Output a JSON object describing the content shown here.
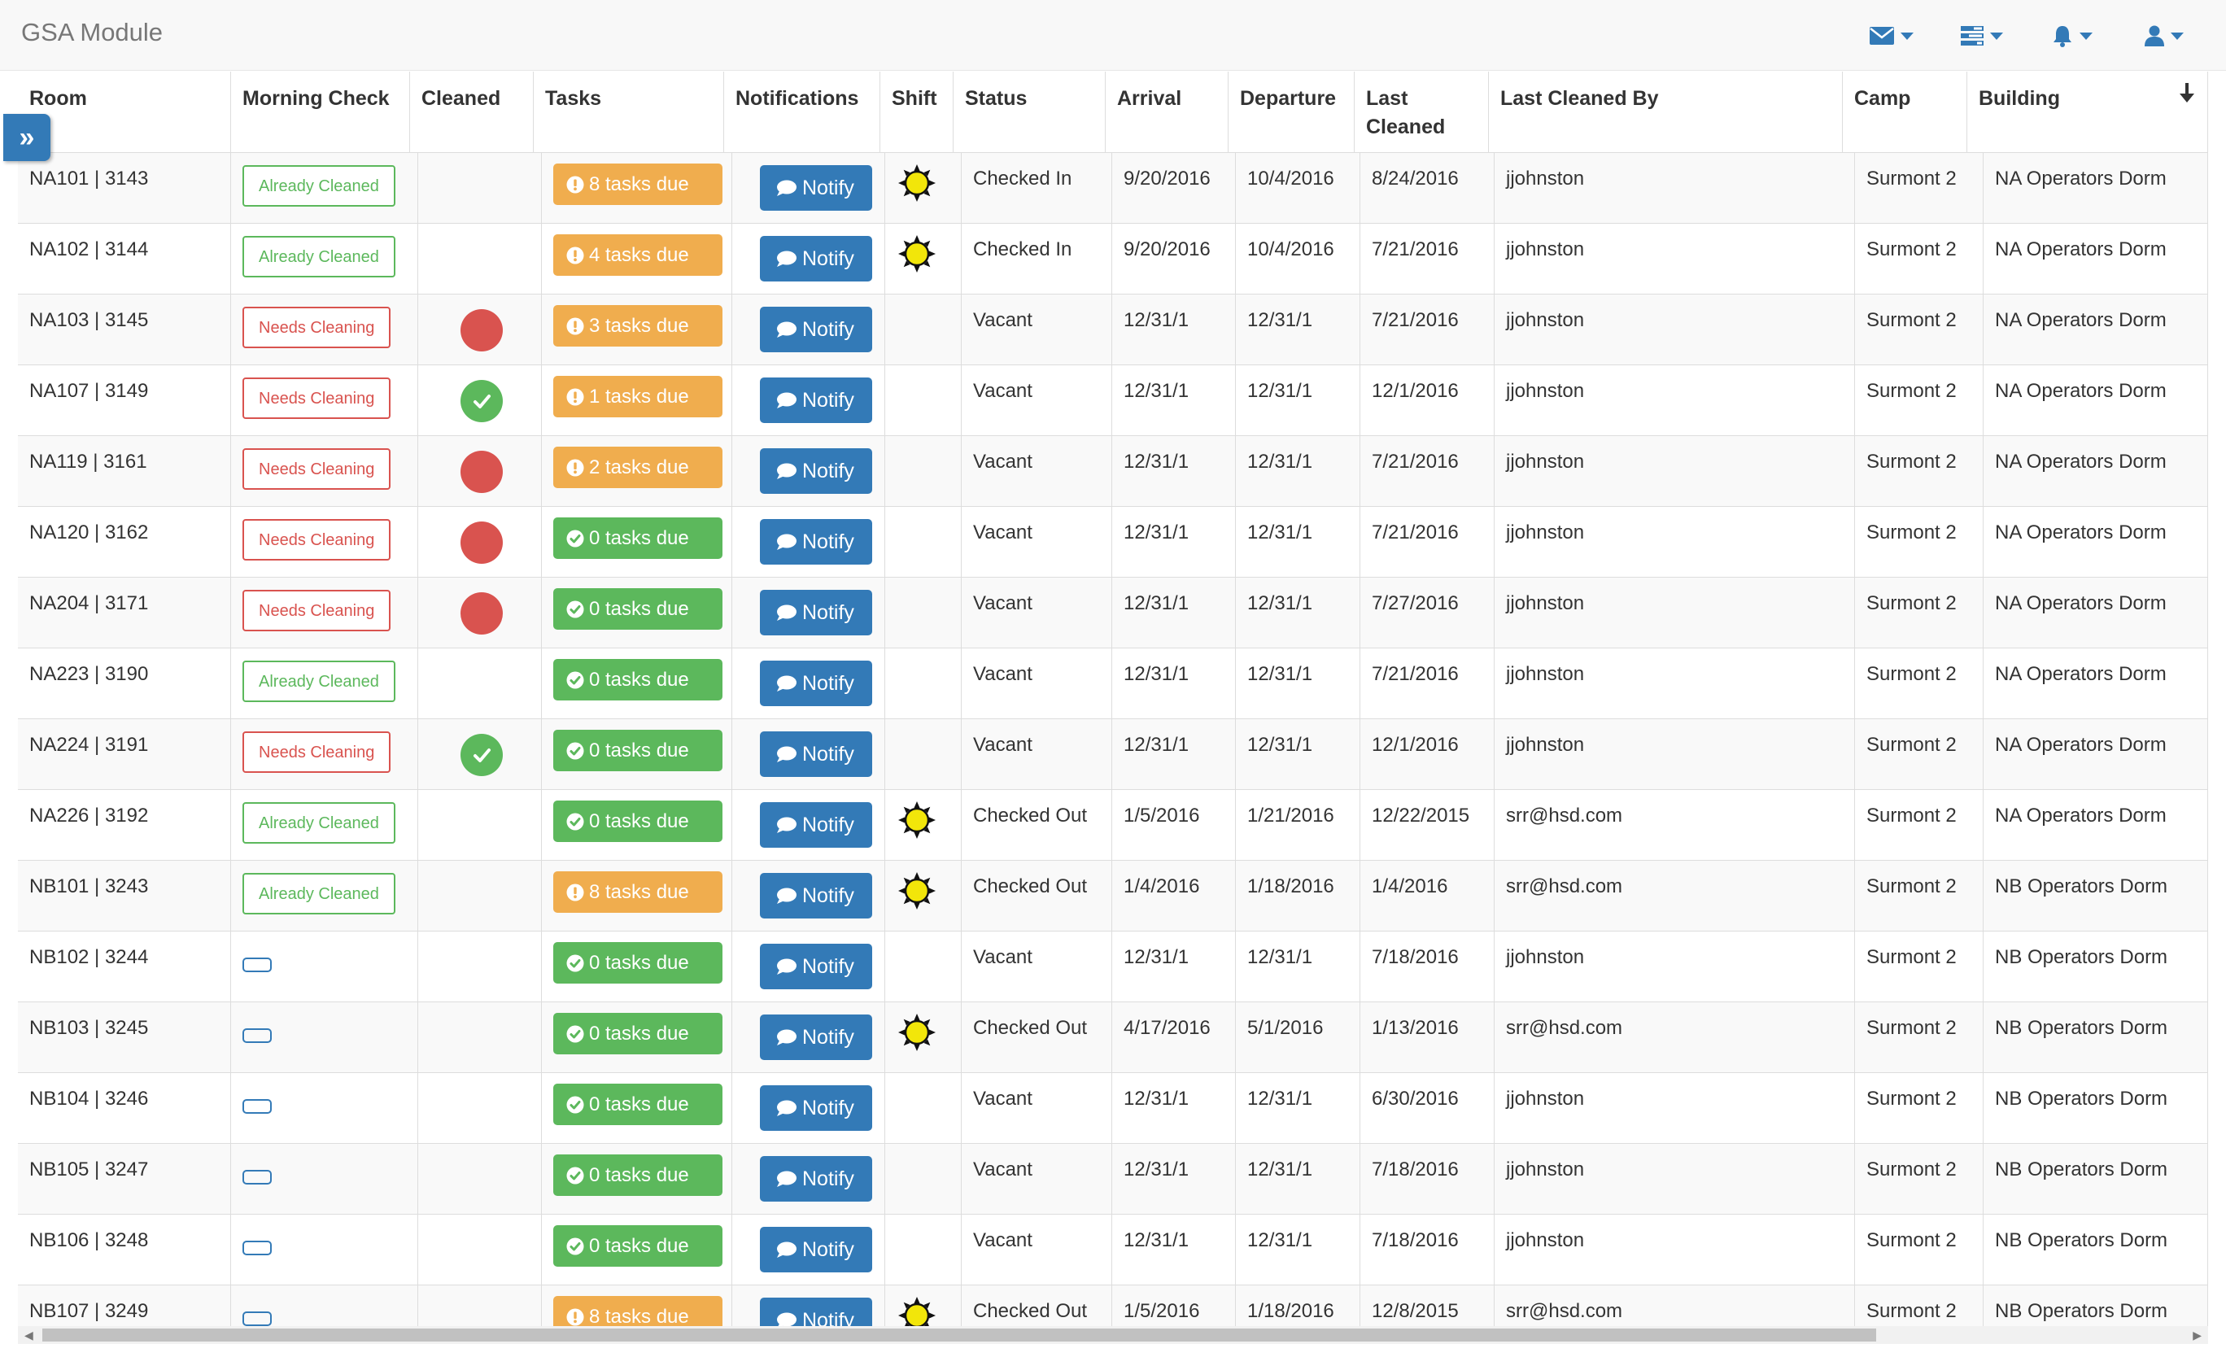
{
  "app": {
    "title": "GSA Module"
  },
  "navbar": {
    "icons": [
      "envelope-icon",
      "tasks-icon",
      "bell-icon",
      "user-icon"
    ]
  },
  "sidebar_toggle": {
    "label": "»"
  },
  "table": {
    "columns": [
      "Room",
      "Morning Check",
      "Cleaned",
      "Tasks",
      "Notifications",
      "Shift",
      "Status",
      "Arrival",
      "Departure",
      "Last Cleaned",
      "Last Cleaned By",
      "Camp",
      "Building"
    ],
    "notify_label": "Notify",
    "rows": [
      {
        "room": "NA101 | 3143",
        "morning_check": "Already Cleaned",
        "cleaned": "",
        "tasks": "8 tasks due",
        "tasks_status": "due",
        "shift": "day",
        "status": "Checked In",
        "arrival": "9/20/2016",
        "departure": "10/4/2016",
        "last_cleaned": "8/24/2016",
        "last_cleaned_by": "jjohnston",
        "camp": "Surmont 2",
        "building": "NA Operators Dorm"
      },
      {
        "room": "NA102 | 3144",
        "morning_check": "Already Cleaned",
        "cleaned": "",
        "tasks": "4 tasks due",
        "tasks_status": "due",
        "shift": "day",
        "status": "Checked In",
        "arrival": "9/20/2016",
        "departure": "10/4/2016",
        "last_cleaned": "7/21/2016",
        "last_cleaned_by": "jjohnston",
        "camp": "Surmont 2",
        "building": "NA Operators Dorm"
      },
      {
        "room": "NA103 | 3145",
        "morning_check": "Needs Cleaning",
        "cleaned": "red",
        "tasks": "3 tasks due",
        "tasks_status": "due",
        "shift": "",
        "status": "Vacant",
        "arrival": "12/31/1",
        "departure": "12/31/1",
        "last_cleaned": "7/21/2016",
        "last_cleaned_by": "jjohnston",
        "camp": "Surmont 2",
        "building": "NA Operators Dorm"
      },
      {
        "room": "NA107 | 3149",
        "morning_check": "Needs Cleaning",
        "cleaned": "green",
        "tasks": "1 tasks due",
        "tasks_status": "due",
        "shift": "",
        "status": "Vacant",
        "arrival": "12/31/1",
        "departure": "12/31/1",
        "last_cleaned": "12/1/2016",
        "last_cleaned_by": "jjohnston",
        "camp": "Surmont 2",
        "building": "NA Operators Dorm"
      },
      {
        "room": "NA119 | 3161",
        "morning_check": "Needs Cleaning",
        "cleaned": "red",
        "tasks": "2 tasks due",
        "tasks_status": "due",
        "shift": "",
        "status": "Vacant",
        "arrival": "12/31/1",
        "departure": "12/31/1",
        "last_cleaned": "7/21/2016",
        "last_cleaned_by": "jjohnston",
        "camp": "Surmont 2",
        "building": "NA Operators Dorm"
      },
      {
        "room": "NA120 | 3162",
        "morning_check": "Needs Cleaning",
        "cleaned": "red",
        "tasks": "0 tasks due",
        "tasks_status": "ok",
        "shift": "",
        "status": "Vacant",
        "arrival": "12/31/1",
        "departure": "12/31/1",
        "last_cleaned": "7/21/2016",
        "last_cleaned_by": "jjohnston",
        "camp": "Surmont 2",
        "building": "NA Operators Dorm"
      },
      {
        "room": "NA204 | 3171",
        "morning_check": "Needs Cleaning",
        "cleaned": "red",
        "tasks": "0 tasks due",
        "tasks_status": "ok",
        "shift": "",
        "status": "Vacant",
        "arrival": "12/31/1",
        "departure": "12/31/1",
        "last_cleaned": "7/27/2016",
        "last_cleaned_by": "jjohnston",
        "camp": "Surmont 2",
        "building": "NA Operators Dorm"
      },
      {
        "room": "NA223 | 3190",
        "morning_check": "Already Cleaned",
        "cleaned": "",
        "tasks": "0 tasks due",
        "tasks_status": "ok",
        "shift": "",
        "status": "Vacant",
        "arrival": "12/31/1",
        "departure": "12/31/1",
        "last_cleaned": "7/21/2016",
        "last_cleaned_by": "jjohnston",
        "camp": "Surmont 2",
        "building": "NA Operators Dorm"
      },
      {
        "room": "NA224 | 3191",
        "morning_check": "Needs Cleaning",
        "cleaned": "green",
        "tasks": "0 tasks due",
        "tasks_status": "ok",
        "shift": "",
        "status": "Vacant",
        "arrival": "12/31/1",
        "departure": "12/31/1",
        "last_cleaned": "12/1/2016",
        "last_cleaned_by": "jjohnston",
        "camp": "Surmont 2",
        "building": "NA Operators Dorm"
      },
      {
        "room": "NA226 | 3192",
        "morning_check": "Already Cleaned",
        "cleaned": "",
        "tasks": "0 tasks due",
        "tasks_status": "ok",
        "shift": "day",
        "status": "Checked Out",
        "arrival": "1/5/2016",
        "departure": "1/21/2016",
        "last_cleaned": "12/22/2015",
        "last_cleaned_by": "srr@hsd.com",
        "camp": "Surmont 2",
        "building": "NA Operators Dorm"
      },
      {
        "room": "NB101 | 3243",
        "morning_check": "Already Cleaned",
        "cleaned": "",
        "tasks": "8 tasks due",
        "tasks_status": "due",
        "shift": "day",
        "status": "Checked Out",
        "arrival": "1/4/2016",
        "departure": "1/18/2016",
        "last_cleaned": "1/4/2016",
        "last_cleaned_by": "srr@hsd.com",
        "camp": "Surmont 2",
        "building": "NB Operators Dorm"
      },
      {
        "room": "NB102 | 3244",
        "morning_check": "",
        "cleaned": "",
        "tasks": "0 tasks due",
        "tasks_status": "ok",
        "shift": "",
        "status": "Vacant",
        "arrival": "12/31/1",
        "departure": "12/31/1",
        "last_cleaned": "7/18/2016",
        "last_cleaned_by": "jjohnston",
        "camp": "Surmont 2",
        "building": "NB Operators Dorm"
      },
      {
        "room": "NB103 | 3245",
        "morning_check": "",
        "cleaned": "",
        "tasks": "0 tasks due",
        "tasks_status": "ok",
        "shift": "day",
        "status": "Checked Out",
        "arrival": "4/17/2016",
        "departure": "5/1/2016",
        "last_cleaned": "1/13/2016",
        "last_cleaned_by": "srr@hsd.com",
        "camp": "Surmont 2",
        "building": "NB Operators Dorm"
      },
      {
        "room": "NB104 | 3246",
        "morning_check": "",
        "cleaned": "",
        "tasks": "0 tasks due",
        "tasks_status": "ok",
        "shift": "",
        "status": "Vacant",
        "arrival": "12/31/1",
        "departure": "12/31/1",
        "last_cleaned": "6/30/2016",
        "last_cleaned_by": "jjohnston",
        "camp": "Surmont 2",
        "building": "NB Operators Dorm"
      },
      {
        "room": "NB105 | 3247",
        "morning_check": "",
        "cleaned": "",
        "tasks": "0 tasks due",
        "tasks_status": "ok",
        "shift": "",
        "status": "Vacant",
        "arrival": "12/31/1",
        "departure": "12/31/1",
        "last_cleaned": "7/18/2016",
        "last_cleaned_by": "jjohnston",
        "camp": "Surmont 2",
        "building": "NB Operators Dorm"
      },
      {
        "room": "NB106 | 3248",
        "morning_check": "",
        "cleaned": "",
        "tasks": "0 tasks due",
        "tasks_status": "ok",
        "shift": "",
        "status": "Vacant",
        "arrival": "12/31/1",
        "departure": "12/31/1",
        "last_cleaned": "7/18/2016",
        "last_cleaned_by": "jjohnston",
        "camp": "Surmont 2",
        "building": "NB Operators Dorm"
      },
      {
        "room": "NB107 | 3249",
        "morning_check": "",
        "cleaned": "",
        "tasks": "8 tasks due",
        "tasks_status": "due",
        "shift": "day",
        "status": "Checked Out",
        "arrival": "1/5/2016",
        "departure": "1/18/2016",
        "last_cleaned": "12/8/2015",
        "last_cleaned_by": "srr@hsd.com",
        "camp": "Surmont 2",
        "building": "NB Operators Dorm"
      }
    ]
  },
  "colors": {
    "primary": "#337ab7",
    "success": "#5cb85c",
    "danger": "#d9534f",
    "warning": "#f0ad4e",
    "sun": "#f2e60a"
  }
}
